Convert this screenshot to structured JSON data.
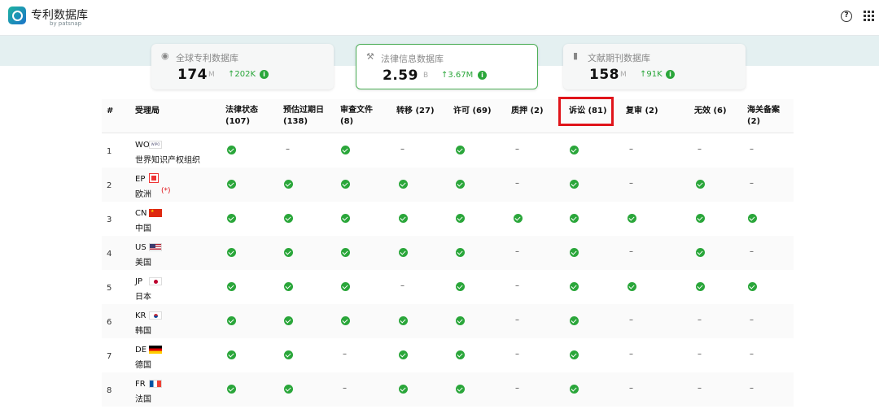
{
  "app": {
    "title": "专利数据库",
    "subtitle": "by patsnap"
  },
  "cards": [
    {
      "label": "全球专利数据库",
      "value": "174",
      "unit": "M",
      "delta": "↑202K",
      "icon": "globe-icon"
    },
    {
      "label": "法律信息数据库",
      "value": "2.59",
      "unit": "B",
      "delta": "↑3.67M",
      "icon": "gavel-icon"
    },
    {
      "label": "文献期刊数据库",
      "value": "158",
      "unit": "M",
      "delta": "↑91K",
      "icon": "book-icon"
    }
  ],
  "table": {
    "headers": [
      {
        "l1": "#",
        "l2": ""
      },
      {
        "l1": "受理局",
        "l2": ""
      },
      {
        "l1": "法律状态",
        "l2": "(107)"
      },
      {
        "l1": "预估过期日",
        "l2": "(138)"
      },
      {
        "l1": "审查文件",
        "l2": "(8)"
      },
      {
        "l1": "转移 (27)",
        "l2": ""
      },
      {
        "l1": "许可 (69)",
        "l2": ""
      },
      {
        "l1": "质押 (2)",
        "l2": ""
      },
      {
        "l1": "诉讼 (81)",
        "l2": ""
      },
      {
        "l1": "复审 (2)",
        "l2": ""
      },
      {
        "l1": "无效 (6)",
        "l2": ""
      },
      {
        "l1": "海关备案",
        "l2": "(2)"
      }
    ],
    "rows": [
      {
        "num": "1",
        "code": "WO",
        "name": "世界知识产权组织",
        "note": "",
        "flag": "wipo",
        "cells": [
          1,
          0,
          1,
          0,
          1,
          0,
          1,
          0,
          0,
          0
        ]
      },
      {
        "num": "2",
        "code": "EP",
        "name": "欧洲",
        "note": "(*)",
        "flag": "ep",
        "cells": [
          1,
          1,
          1,
          1,
          1,
          0,
          1,
          0,
          1,
          0
        ]
      },
      {
        "num": "3",
        "code": "CN",
        "name": "中国",
        "note": "",
        "flag": "cn",
        "cells": [
          1,
          1,
          1,
          1,
          1,
          1,
          1,
          1,
          1,
          1
        ]
      },
      {
        "num": "4",
        "code": "US",
        "name": "美国",
        "note": "",
        "flag": "us",
        "cells": [
          1,
          1,
          1,
          1,
          1,
          0,
          1,
          0,
          1,
          0
        ]
      },
      {
        "num": "5",
        "code": "JP",
        "name": "日本",
        "note": "",
        "flag": "jp",
        "cells": [
          1,
          1,
          1,
          0,
          1,
          0,
          1,
          1,
          1,
          1
        ]
      },
      {
        "num": "6",
        "code": "KR",
        "name": "韩国",
        "note": "",
        "flag": "kr",
        "cells": [
          1,
          1,
          1,
          1,
          1,
          0,
          1,
          0,
          0,
          0
        ]
      },
      {
        "num": "7",
        "code": "DE",
        "name": "德国",
        "note": "",
        "flag": "de",
        "cells": [
          1,
          1,
          0,
          1,
          1,
          0,
          1,
          0,
          0,
          0
        ]
      },
      {
        "num": "8",
        "code": "FR",
        "name": "法国",
        "note": "",
        "flag": "fr",
        "cells": [
          1,
          1,
          0,
          1,
          1,
          0,
          1,
          0,
          0,
          0
        ]
      }
    ],
    "dash": "–",
    "wipo_badge": "WIPO"
  },
  "colors": {
    "accent": "#2aa63a",
    "highlight": "#e0141a"
  }
}
